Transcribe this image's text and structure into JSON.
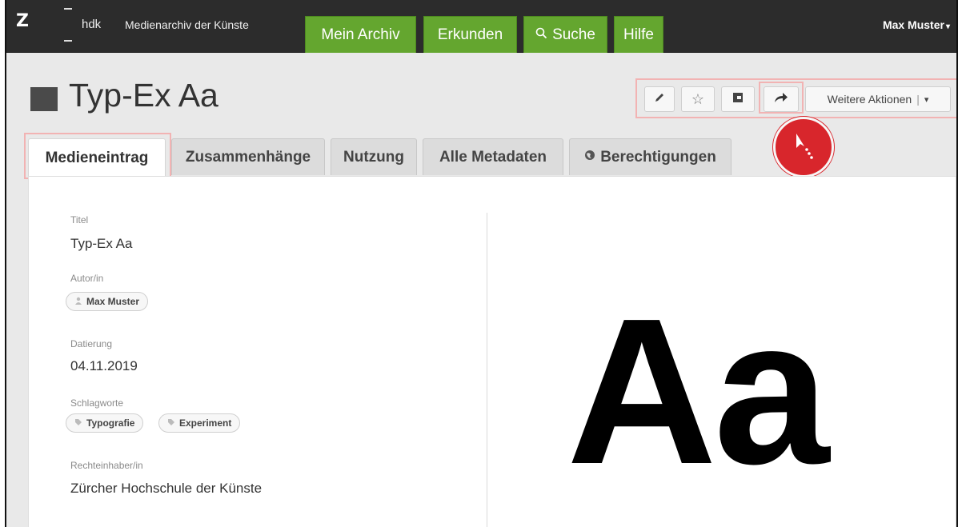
{
  "topbar": {
    "logo_letter": "Z",
    "logo_text": "hdk",
    "brand": "Medienarchiv der Künste",
    "nav": [
      {
        "label": "Mein Archiv"
      },
      {
        "label": "Erkunden"
      },
      {
        "label": "Suche",
        "icon": "search-icon"
      },
      {
        "label": "Hilfe"
      }
    ],
    "user": "Max Muster",
    "user_caret": "▾"
  },
  "header": {
    "title": "Typ-Ex Aa",
    "actions": {
      "edit_icon": "pencil-icon",
      "favorite_icon": "star-icon",
      "clipboard_icon": "clipboard-icon",
      "share_icon": "share-arrow-icon",
      "more_label": "Weitere Aktionen",
      "more_caret": "▾"
    }
  },
  "tabs": [
    {
      "label": "Medieneintrag",
      "active": true
    },
    {
      "label": "Zusammenhänge"
    },
    {
      "label": "Nutzung"
    },
    {
      "label": "Alle Metadaten"
    },
    {
      "label": "Berechtigungen",
      "icon": "globe-icon"
    }
  ],
  "metadata": {
    "title_label": "Titel",
    "title_value": "Typ-Ex Aa",
    "author_label": "Autor/in",
    "author_value": "Max Muster",
    "date_label": "Datierung",
    "date_value": "04.11.2019",
    "keywords_label": "Schlagworte",
    "keywords": [
      "Typografie",
      "Experiment"
    ],
    "rights_label": "Rechteinhaber/in",
    "rights_value": "Zürcher Hochschule der Künste"
  },
  "preview": {
    "text": "Aa"
  },
  "colors": {
    "nav_green": "#64a62f",
    "topbar_dark": "#2c2c2c",
    "highlight_outline": "#f2b3b3",
    "cursor_badge_red": "#d8262c"
  }
}
